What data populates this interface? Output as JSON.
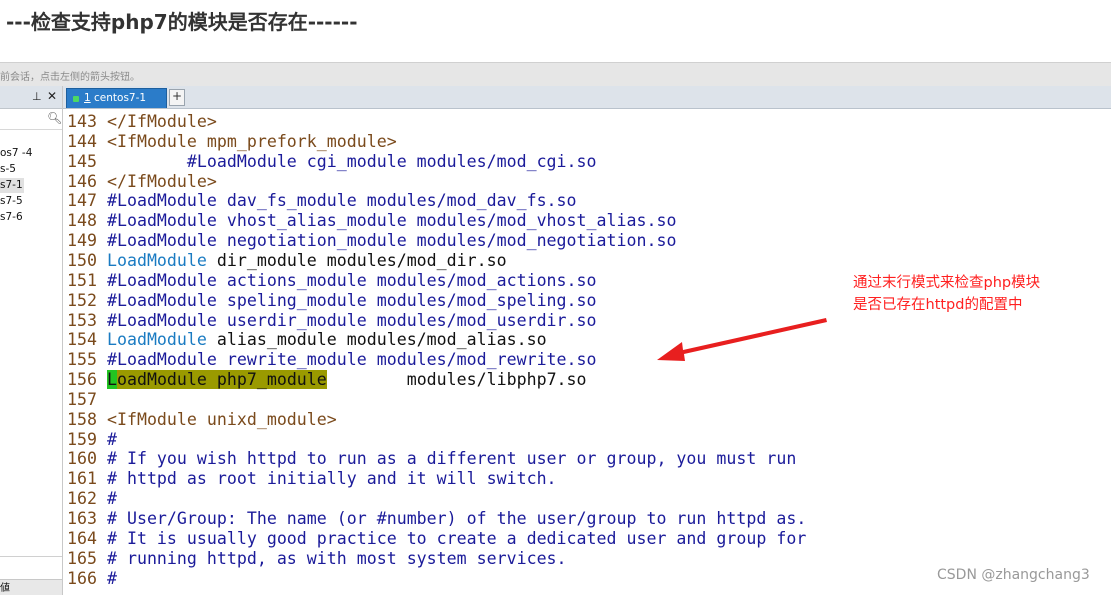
{
  "heading": "---检查支持php7的模块是否存在------",
  "hint_bar": {
    "text": "前会话，点击左侧的箭头按钮。"
  },
  "sessions_panel": {
    "items": [
      "os7 -4",
      "s-5",
      "s7-1",
      "s7-5",
      "s7-6"
    ],
    "selected": "s7-1",
    "bottom_tab": "値"
  },
  "tabs": {
    "active": {
      "number": "1",
      "label": "centos7-1"
    },
    "add_label": "+"
  },
  "terminal": {
    "lines": [
      {
        "n": "143",
        "parts": [
          {
            "t": "</IfModule>",
            "c": "tag"
          }
        ]
      },
      {
        "n": "144",
        "parts": [
          {
            "t": "<IfModule mpm_prefork_module>",
            "c": "tag"
          }
        ]
      },
      {
        "n": "145",
        "parts": [
          {
            "t": "        #LoadModule cgi_module modules/mod_cgi.so",
            "c": "com"
          }
        ]
      },
      {
        "n": "146",
        "parts": [
          {
            "t": "</IfModule>",
            "c": "tag"
          }
        ]
      },
      {
        "n": "147",
        "parts": [
          {
            "t": "#LoadModule dav_fs_module modules/mod_dav_fs.so",
            "c": "com"
          }
        ]
      },
      {
        "n": "148",
        "parts": [
          {
            "t": "#LoadModule vhost_alias_module modules/mod_vhost_alias.so",
            "c": "com"
          }
        ]
      },
      {
        "n": "149",
        "parts": [
          {
            "t": "#LoadModule negotiation_module modules/mod_negotiation.so",
            "c": "com"
          }
        ]
      },
      {
        "n": "150",
        "parts": [
          {
            "t": "LoadModule",
            "c": "kw"
          },
          {
            "t": " dir_module modules/mod_dir.so",
            "c": "txt"
          }
        ]
      },
      {
        "n": "151",
        "parts": [
          {
            "t": "#LoadModule actions_module modules/mod_actions.so",
            "c": "com"
          }
        ]
      },
      {
        "n": "152",
        "parts": [
          {
            "t": "#LoadModule speling_module modules/mod_speling.so",
            "c": "com"
          }
        ]
      },
      {
        "n": "153",
        "parts": [
          {
            "t": "#LoadModule userdir_module modules/mod_userdir.so",
            "c": "com"
          }
        ]
      },
      {
        "n": "154",
        "parts": [
          {
            "t": "LoadModule",
            "c": "kw"
          },
          {
            "t": " alias_module modules/mod_alias.so",
            "c": "txt"
          }
        ]
      },
      {
        "n": "155",
        "parts": [
          {
            "t": "#LoadModule rewrite_module modules/mod_rewrite.so",
            "c": "com"
          }
        ]
      },
      {
        "n": "156",
        "parts": [
          {
            "t": "L",
            "c": "cursor"
          },
          {
            "t": "oadModule php7_module",
            "c": "hl"
          },
          {
            "t": "        modules/libphp7.so",
            "c": "txt"
          }
        ]
      },
      {
        "n": "157",
        "parts": []
      },
      {
        "n": "158",
        "parts": [
          {
            "t": "<IfModule unixd_module>",
            "c": "tag"
          }
        ]
      },
      {
        "n": "159",
        "parts": [
          {
            "t": "#",
            "c": "com"
          }
        ]
      },
      {
        "n": "160",
        "parts": [
          {
            "t": "# If you wish httpd to run as a different user or group, you must run",
            "c": "com"
          }
        ]
      },
      {
        "n": "161",
        "parts": [
          {
            "t": "# httpd as root initially and it will switch.",
            "c": "com"
          }
        ]
      },
      {
        "n": "162",
        "parts": [
          {
            "t": "#",
            "c": "com"
          }
        ]
      },
      {
        "n": "163",
        "parts": [
          {
            "t": "# User/Group: The name (or #number) of the user/group to run httpd as.",
            "c": "com"
          }
        ]
      },
      {
        "n": "164",
        "parts": [
          {
            "t": "# It is usually good practice to create a dedicated user and group for",
            "c": "com"
          }
        ]
      },
      {
        "n": "165",
        "parts": [
          {
            "t": "# running httpd, as with most system services.",
            "c": "com"
          }
        ]
      },
      {
        "n": "166",
        "parts": [
          {
            "t": "#",
            "c": "com"
          }
        ]
      }
    ]
  },
  "annotation": {
    "line1": "通过末行模式来检查php模块",
    "line2": "是否已存在httpd的配置中"
  },
  "watermark": "CSDN @zhangchang3",
  "colors": {
    "tag": "#7a4a1c",
    "keyword": "#1a7bc2",
    "comment": "#1b1b9a",
    "highlight": "#9a9a00",
    "cursor": "#22c522",
    "annotation": "#ff2020",
    "tab_active": "#2b7cc9"
  },
  "icons": [
    "pin-icon",
    "close-icon",
    "search-icon",
    "status-dot-icon",
    "plus-icon",
    "arrow-annotation"
  ]
}
